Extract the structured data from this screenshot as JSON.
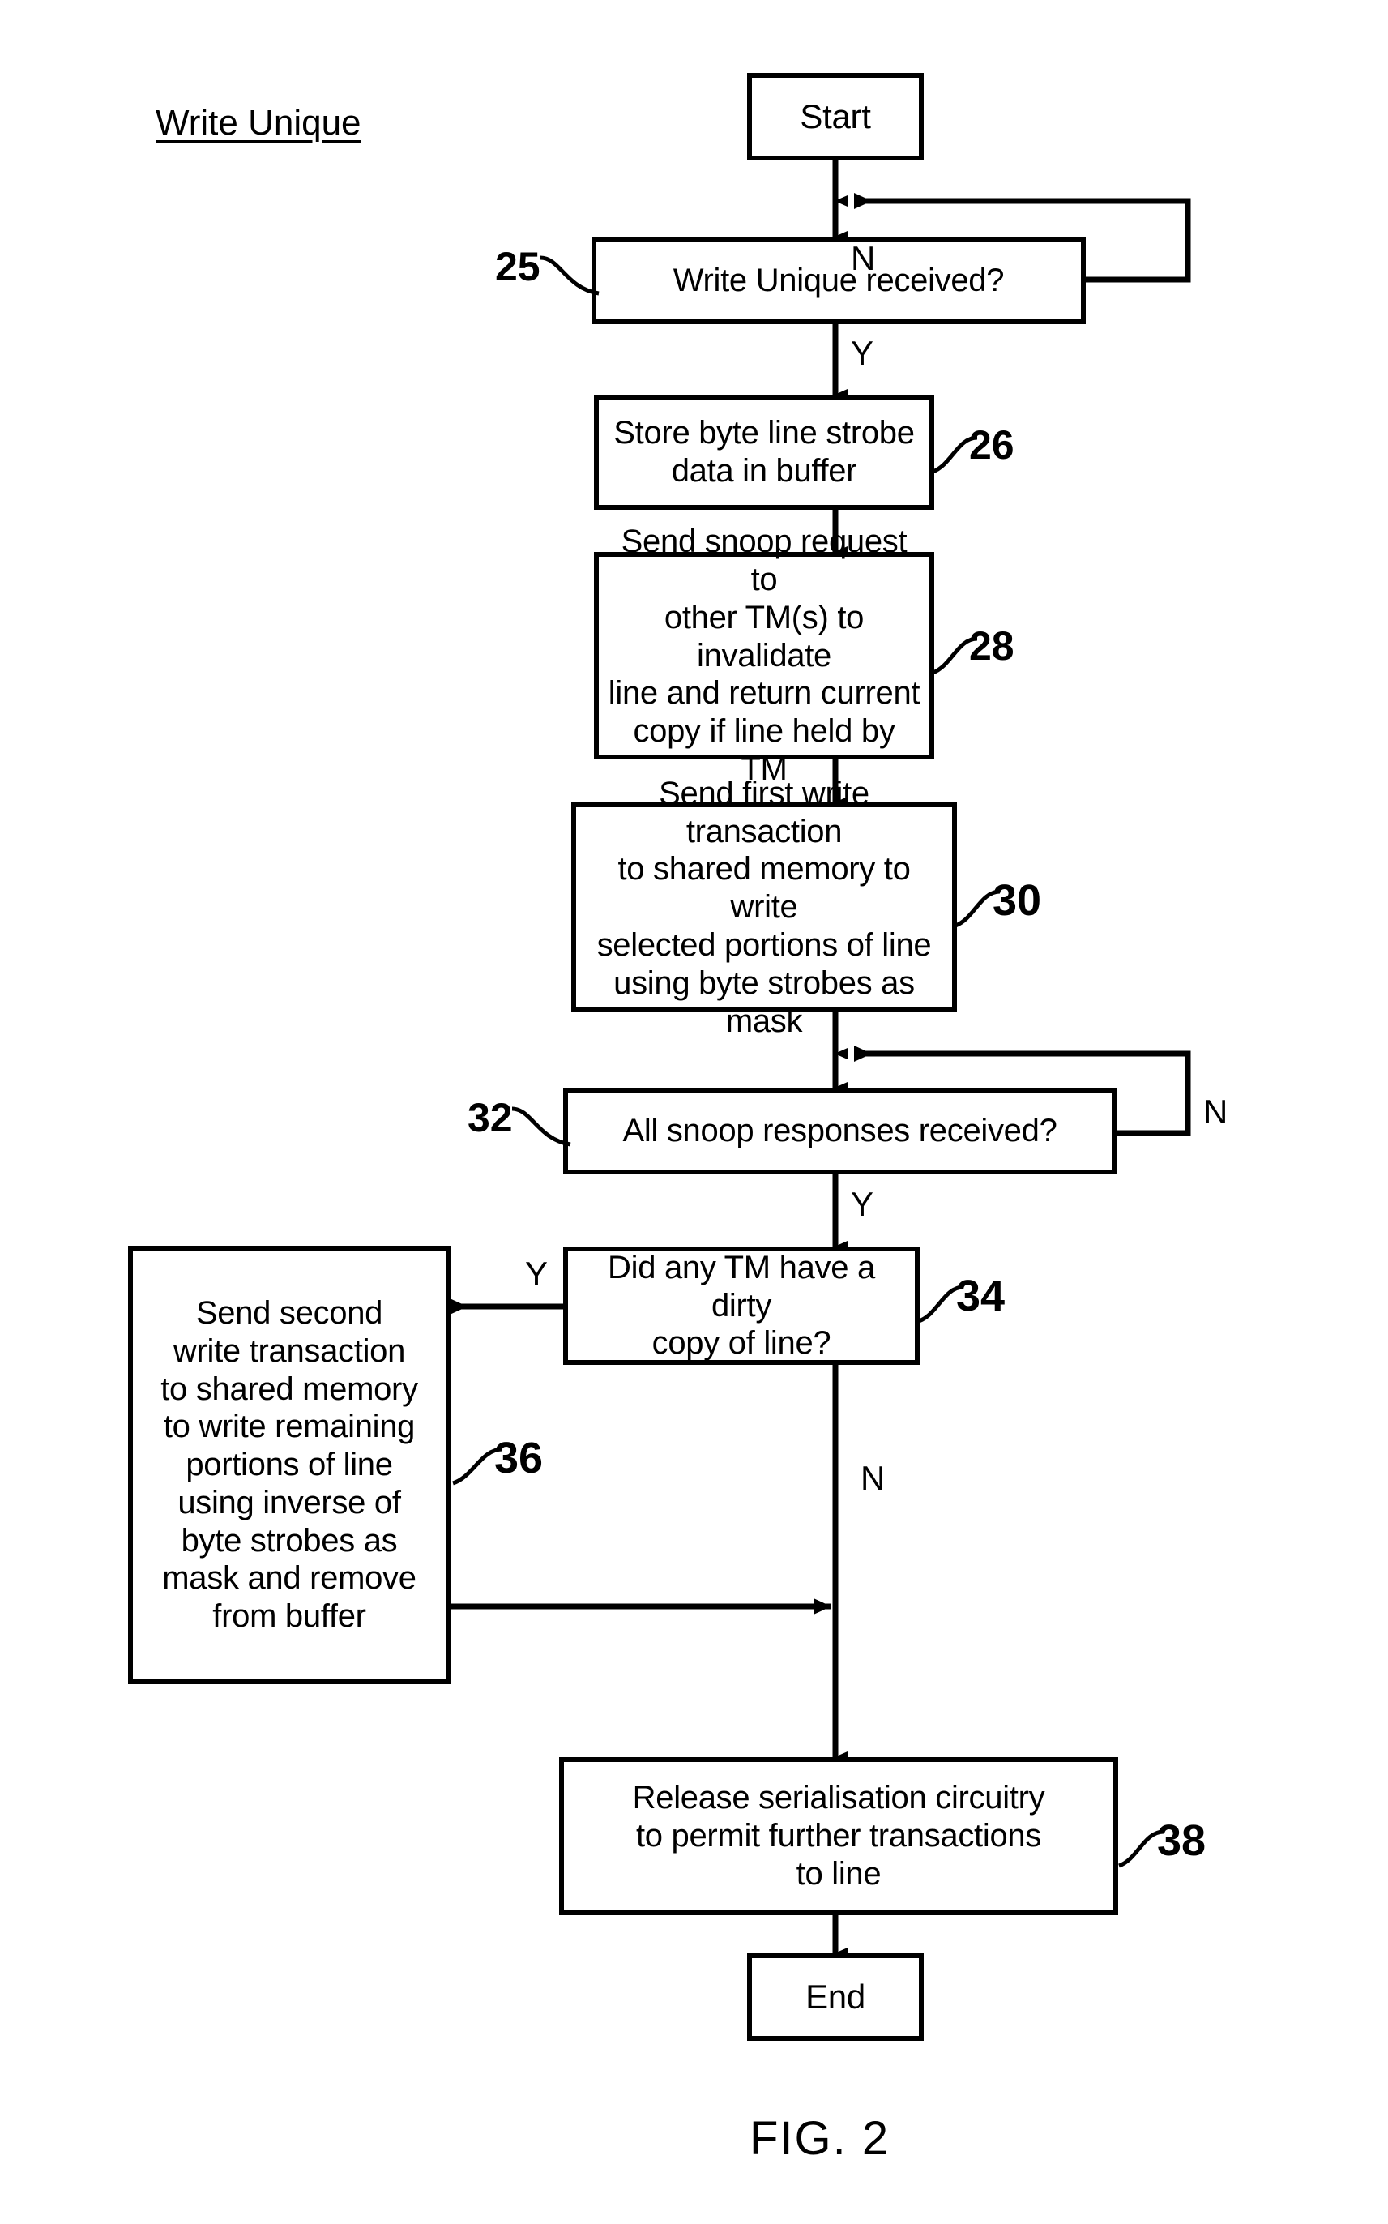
{
  "figure": {
    "title": "Write Unique",
    "caption": "FIG. 2"
  },
  "nodes": {
    "start": {
      "label": "Start",
      "shape": "terminator"
    },
    "n25": {
      "label": "Write Unique received?",
      "ref": "25",
      "shape": "decision"
    },
    "n26": {
      "label": "Store byte line strobe data in buffer",
      "ref": "26",
      "shape": "process"
    },
    "n28": {
      "label": "Send snoop request to other TM(s) to invalidate line and return current copy if line held by TM",
      "ref": "28",
      "shape": "process"
    },
    "n30": {
      "label": "Send first write transaction to shared memory to write selected portions of line using byte strobes as mask",
      "ref": "30",
      "shape": "process"
    },
    "n32": {
      "label": "All snoop responses received?",
      "ref": "32",
      "shape": "decision"
    },
    "n34": {
      "label": "Did any TM have a dirty copy of line?",
      "ref": "34",
      "shape": "decision"
    },
    "n36": {
      "label": "Send second write transaction to shared memory to write remaining portions of line using inverse of byte strobes as mask and remove from buffer",
      "ref": "36",
      "shape": "process"
    },
    "n38": {
      "label": "Release serialisation circuitry to permit further transactions to line",
      "ref": "38",
      "shape": "process"
    },
    "end": {
      "label": "End",
      "shape": "terminator"
    }
  },
  "node_lines": {
    "start": [
      "Start"
    ],
    "n25": [
      "Write Unique received?"
    ],
    "n26": [
      "Store byte line strobe",
      "data in buffer"
    ],
    "n28": [
      "Send snoop request to",
      "other TM(s) to invalidate",
      "line and return current",
      "copy if line held by TM"
    ],
    "n30": [
      "Send first write transaction",
      "to shared memory to write",
      "selected portions of line",
      "using byte strobes as mask"
    ],
    "n32": [
      "All snoop responses received?"
    ],
    "n34": [
      "Did any TM have a dirty",
      "copy of line?"
    ],
    "n36": [
      "Send second",
      "write transaction",
      "to shared memory",
      "to write remaining",
      "portions of line",
      "using inverse of",
      "byte strobes as",
      "mask and remove",
      "from buffer"
    ],
    "n38": [
      "Release serialisation circuitry",
      "to permit further transactions",
      "to line"
    ],
    "end": [
      "End"
    ]
  },
  "branch_labels": {
    "n25_no": "N",
    "n25_yes": "Y",
    "n32_no": "N",
    "n32_yes": "Y",
    "n34_yes": "Y",
    "n34_no": "N"
  },
  "colors": {
    "stroke": "#000000",
    "background": "#ffffff",
    "text": "#000000"
  }
}
